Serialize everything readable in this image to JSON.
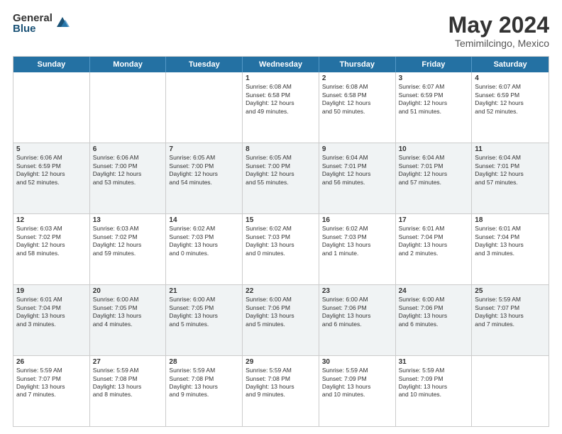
{
  "logo": {
    "general": "General",
    "blue": "Blue"
  },
  "title": "May 2024",
  "location": "Temimilcingo, Mexico",
  "header": {
    "days": [
      "Sunday",
      "Monday",
      "Tuesday",
      "Wednesday",
      "Thursday",
      "Friday",
      "Saturday"
    ]
  },
  "rows": [
    [
      {
        "day": "",
        "text": ""
      },
      {
        "day": "",
        "text": ""
      },
      {
        "day": "",
        "text": ""
      },
      {
        "day": "1",
        "text": "Sunrise: 6:08 AM\nSunset: 6:58 PM\nDaylight: 12 hours\nand 49 minutes."
      },
      {
        "day": "2",
        "text": "Sunrise: 6:08 AM\nSunset: 6:58 PM\nDaylight: 12 hours\nand 50 minutes."
      },
      {
        "day": "3",
        "text": "Sunrise: 6:07 AM\nSunset: 6:59 PM\nDaylight: 12 hours\nand 51 minutes."
      },
      {
        "day": "4",
        "text": "Sunrise: 6:07 AM\nSunset: 6:59 PM\nDaylight: 12 hours\nand 52 minutes."
      }
    ],
    [
      {
        "day": "5",
        "text": "Sunrise: 6:06 AM\nSunset: 6:59 PM\nDaylight: 12 hours\nand 52 minutes."
      },
      {
        "day": "6",
        "text": "Sunrise: 6:06 AM\nSunset: 7:00 PM\nDaylight: 12 hours\nand 53 minutes."
      },
      {
        "day": "7",
        "text": "Sunrise: 6:05 AM\nSunset: 7:00 PM\nDaylight: 12 hours\nand 54 minutes."
      },
      {
        "day": "8",
        "text": "Sunrise: 6:05 AM\nSunset: 7:00 PM\nDaylight: 12 hours\nand 55 minutes."
      },
      {
        "day": "9",
        "text": "Sunrise: 6:04 AM\nSunset: 7:01 PM\nDaylight: 12 hours\nand 56 minutes."
      },
      {
        "day": "10",
        "text": "Sunrise: 6:04 AM\nSunset: 7:01 PM\nDaylight: 12 hours\nand 57 minutes."
      },
      {
        "day": "11",
        "text": "Sunrise: 6:04 AM\nSunset: 7:01 PM\nDaylight: 12 hours\nand 57 minutes."
      }
    ],
    [
      {
        "day": "12",
        "text": "Sunrise: 6:03 AM\nSunset: 7:02 PM\nDaylight: 12 hours\nand 58 minutes."
      },
      {
        "day": "13",
        "text": "Sunrise: 6:03 AM\nSunset: 7:02 PM\nDaylight: 12 hours\nand 59 minutes."
      },
      {
        "day": "14",
        "text": "Sunrise: 6:02 AM\nSunset: 7:03 PM\nDaylight: 13 hours\nand 0 minutes."
      },
      {
        "day": "15",
        "text": "Sunrise: 6:02 AM\nSunset: 7:03 PM\nDaylight: 13 hours\nand 0 minutes."
      },
      {
        "day": "16",
        "text": "Sunrise: 6:02 AM\nSunset: 7:03 PM\nDaylight: 13 hours\nand 1 minute."
      },
      {
        "day": "17",
        "text": "Sunrise: 6:01 AM\nSunset: 7:04 PM\nDaylight: 13 hours\nand 2 minutes."
      },
      {
        "day": "18",
        "text": "Sunrise: 6:01 AM\nSunset: 7:04 PM\nDaylight: 13 hours\nand 3 minutes."
      }
    ],
    [
      {
        "day": "19",
        "text": "Sunrise: 6:01 AM\nSunset: 7:04 PM\nDaylight: 13 hours\nand 3 minutes."
      },
      {
        "day": "20",
        "text": "Sunrise: 6:00 AM\nSunset: 7:05 PM\nDaylight: 13 hours\nand 4 minutes."
      },
      {
        "day": "21",
        "text": "Sunrise: 6:00 AM\nSunset: 7:05 PM\nDaylight: 13 hours\nand 5 minutes."
      },
      {
        "day": "22",
        "text": "Sunrise: 6:00 AM\nSunset: 7:06 PM\nDaylight: 13 hours\nand 5 minutes."
      },
      {
        "day": "23",
        "text": "Sunrise: 6:00 AM\nSunset: 7:06 PM\nDaylight: 13 hours\nand 6 minutes."
      },
      {
        "day": "24",
        "text": "Sunrise: 6:00 AM\nSunset: 7:06 PM\nDaylight: 13 hours\nand 6 minutes."
      },
      {
        "day": "25",
        "text": "Sunrise: 5:59 AM\nSunset: 7:07 PM\nDaylight: 13 hours\nand 7 minutes."
      }
    ],
    [
      {
        "day": "26",
        "text": "Sunrise: 5:59 AM\nSunset: 7:07 PM\nDaylight: 13 hours\nand 7 minutes."
      },
      {
        "day": "27",
        "text": "Sunrise: 5:59 AM\nSunset: 7:08 PM\nDaylight: 13 hours\nand 8 minutes."
      },
      {
        "day": "28",
        "text": "Sunrise: 5:59 AM\nSunset: 7:08 PM\nDaylight: 13 hours\nand 9 minutes."
      },
      {
        "day": "29",
        "text": "Sunrise: 5:59 AM\nSunset: 7:08 PM\nDaylight: 13 hours\nand 9 minutes."
      },
      {
        "day": "30",
        "text": "Sunrise: 5:59 AM\nSunset: 7:09 PM\nDaylight: 13 hours\nand 10 minutes."
      },
      {
        "day": "31",
        "text": "Sunrise: 5:59 AM\nSunset: 7:09 PM\nDaylight: 13 hours\nand 10 minutes."
      },
      {
        "day": "",
        "text": ""
      }
    ]
  ]
}
